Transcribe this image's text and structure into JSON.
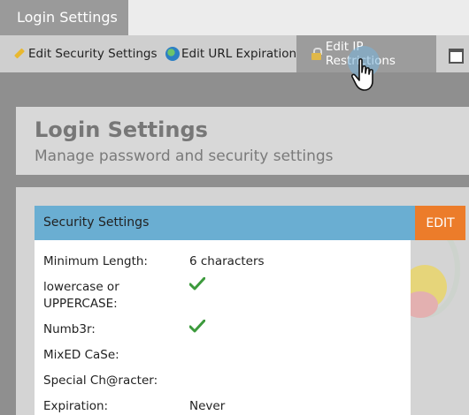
{
  "top_tab": {
    "label": "Login Settings"
  },
  "toolbar": {
    "items": [
      {
        "label": "Edit Security Settings",
        "icon": "pencil-icon"
      },
      {
        "label": "Edit URL Expiration",
        "icon": "globe-icon"
      },
      {
        "label": "Edit IP Restrictions",
        "icon": "lock-icon"
      }
    ],
    "more_icon": "window-icon"
  },
  "header": {
    "title": "Login Settings",
    "subtitle": "Manage password and security settings"
  },
  "security_settings": {
    "title": "Security Settings",
    "edit_label": "EDIT",
    "rows": [
      {
        "label": "Minimum Length:",
        "value": "6 characters"
      },
      {
        "label": "lowercase or",
        "label2": "UPPERCASE:",
        "value": "",
        "checked": true
      },
      {
        "label": "Numb3r:",
        "value": "",
        "checked": true
      },
      {
        "label": "MixED CaSe:",
        "value": ""
      },
      {
        "label": "Special Ch@racter:",
        "value": ""
      },
      {
        "label": "Expiration:",
        "value": "Never"
      }
    ]
  },
  "colors": {
    "accent_blue": "#6aaed2",
    "edit_orange": "#ec7c2a",
    "check_green": "#3c9a3c"
  }
}
